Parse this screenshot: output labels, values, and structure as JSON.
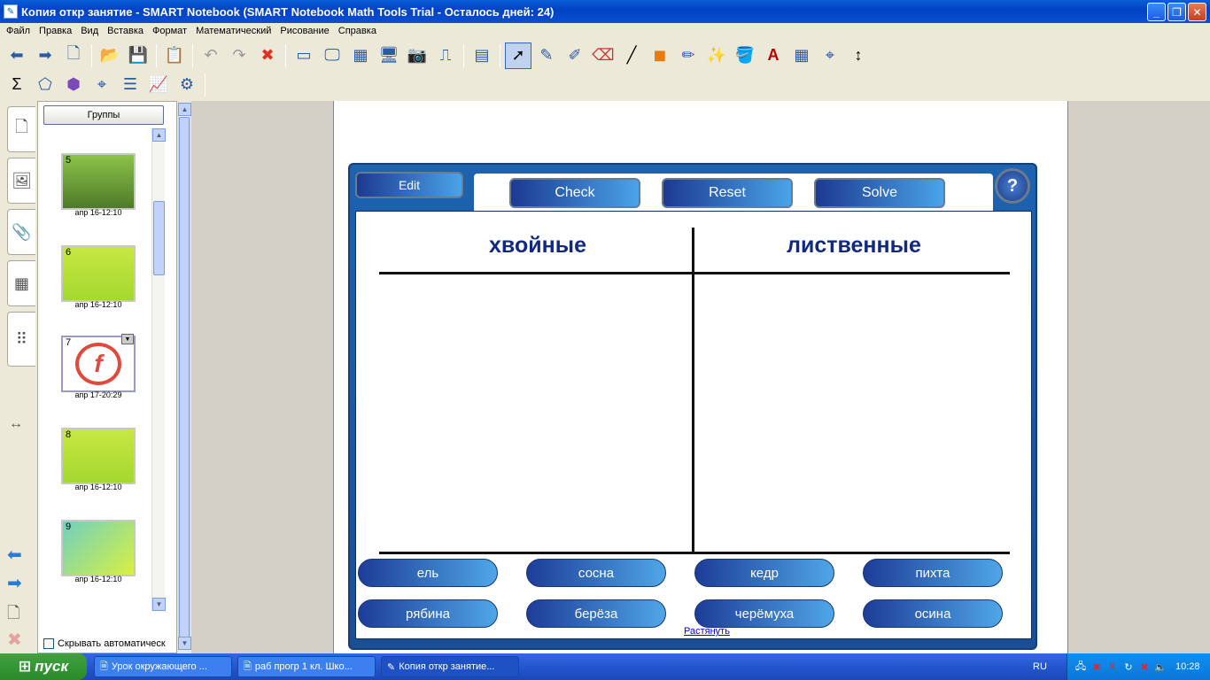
{
  "window": {
    "title": "Копия откр занятие  - SMART Notebook (SMART Notebook Math Tools Trial - Осталось дней: 24)"
  },
  "menu": [
    "Файл",
    "Правка",
    "Вид",
    "Вставка",
    "Формат",
    "Математический",
    "Рисование",
    "Справка"
  ],
  "sorter": {
    "groups_label": "Группы",
    "autohide_label": "Скрывать автоматическ",
    "thumbs": [
      {
        "num": "5",
        "date": "апр 16-12:10"
      },
      {
        "num": "6",
        "date": "апр 16-12:10"
      },
      {
        "num": "7",
        "date": "апр 17-20:29"
      },
      {
        "num": "8",
        "date": "апр 16-12:10"
      },
      {
        "num": "9",
        "date": "апр 16-12:10"
      }
    ]
  },
  "activity": {
    "edit_label": "Edit",
    "check_label": "Check",
    "reset_label": "Reset",
    "solve_label": "Solve",
    "help_label": "?",
    "col_left": "хвойные",
    "col_right": "лиственные",
    "chips": [
      "ель",
      "сосна",
      "кедр",
      "пихта",
      "рябина",
      "берёза",
      "черёмуха",
      "осина"
    ],
    "stretch_label": "Растянуть"
  },
  "taskbar": {
    "start_label": "пуск",
    "tasks": [
      "Урок окружающего ...",
      "раб прогр 1 кл. Шко...",
      "Копия откр занятие..."
    ],
    "lang": "RU",
    "clock": "10:28"
  }
}
